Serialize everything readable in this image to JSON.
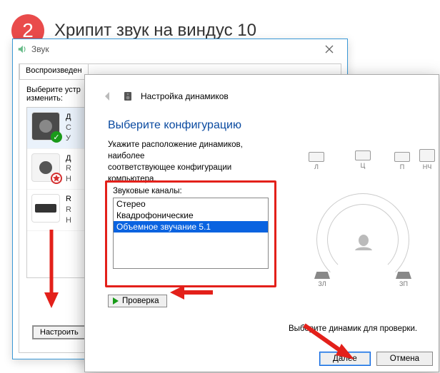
{
  "page": {
    "step_number": "2",
    "title": "Хрипит звук на виндус 10"
  },
  "sound_dialog": {
    "title": "Звук",
    "tab_playback": "Воспроизведен",
    "hint_line1": "Выберите устр",
    "hint_line2": "изменить:",
    "device1_line1": "Д",
    "device1_line2": "С",
    "device1_line3": "У",
    "device2_line1": "Д",
    "device2_line2": "R",
    "device2_line3": "Н",
    "device3_line1": "R",
    "device3_line2": "R",
    "device3_line3": "Н",
    "configure_btn": "Настроить"
  },
  "wizard": {
    "header_title": "Настройка динамиков",
    "heading": "Выберите конфигурацию",
    "subtext_line1": "Укажите расположение динамиков, наиболее",
    "subtext_line2": "соответствующее конфигурации компьютера.",
    "channels_label": "Звуковые каналы:",
    "channel_options": {
      "o0": "Стерео",
      "o1": "Квадрофонические",
      "o2": "Объемное звучание 5.1"
    },
    "test_btn": "Проверка",
    "speaker_labels": {
      "L": "Л",
      "C": "Ц",
      "R": "П",
      "SUB": "НЧ",
      "SL": "ЗЛ",
      "SR": "ЗП"
    },
    "bottom_hint": "Выберите динамик для проверки.",
    "btn_next": "Далее",
    "btn_cancel": "Отмена"
  }
}
